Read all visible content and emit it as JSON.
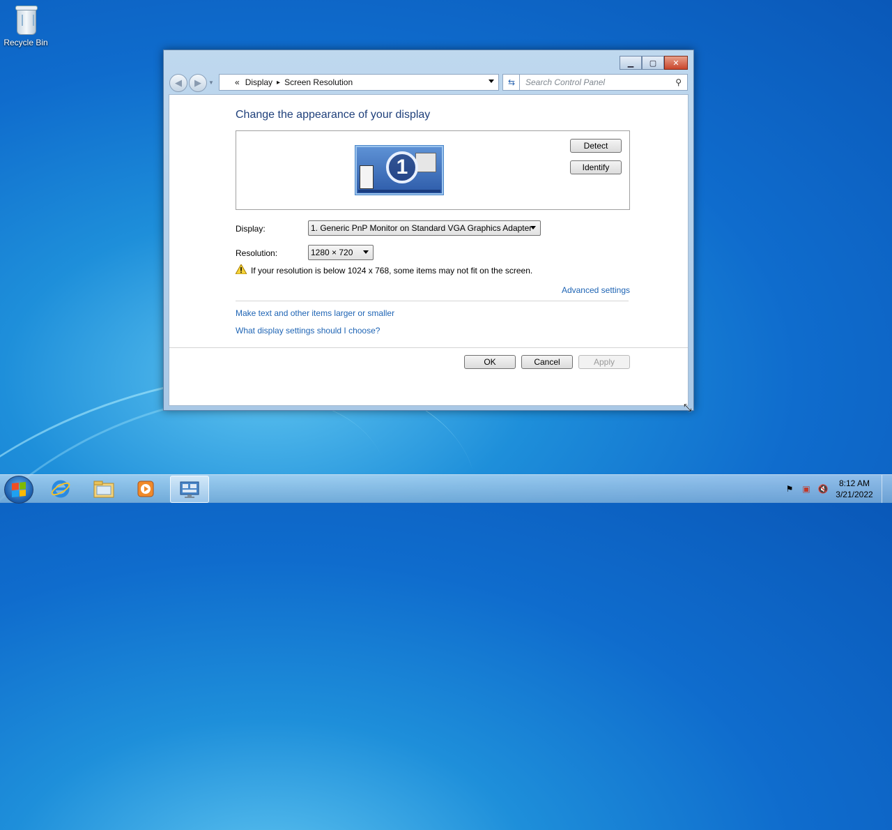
{
  "desktop": {
    "recycle_bin_label": "Recycle Bin"
  },
  "window": {
    "address": {
      "chevrons": "«",
      "crumbs": [
        "Display",
        "Screen Resolution"
      ],
      "separator": "▸"
    },
    "search_placeholder": "Search Control Panel",
    "heading": "Change the appearance of your display",
    "monitor_number": "1",
    "detect_label": "Detect",
    "identify_label": "Identify",
    "display_label": "Display:",
    "display_value": "1. Generic PnP Monitor on Standard VGA Graphics Adapter",
    "resolution_label": "Resolution:",
    "resolution_value": "1280 × 720",
    "warning_text": "If your resolution is below 1024 x 768, some items may not fit on the screen.",
    "advanced_link": "Advanced settings",
    "link_text_size": "Make text and other items larger or smaller",
    "link_help": "What display settings should I choose?",
    "ok_label": "OK",
    "cancel_label": "Cancel",
    "apply_label": "Apply"
  },
  "taskbar": {
    "time": "8:12 AM",
    "date": "3/21/2022"
  },
  "colors": {
    "heading": "#1e3f7a",
    "link": "#1e64b4",
    "close_button": "#c9462c"
  }
}
